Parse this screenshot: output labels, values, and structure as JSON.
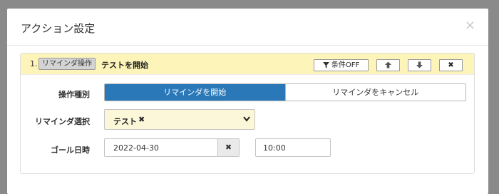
{
  "modal": {
    "title": "アクション設定",
    "close_glyph": "×"
  },
  "action": {
    "step_number": "1.",
    "type_tag": "リマインダ操作",
    "title": "テストを開始",
    "buttons": {
      "condition_label": "条件OFF",
      "condition_icon": "filter-icon",
      "move_up_icon": "arrow-up-icon",
      "move_down_icon": "arrow-down-icon",
      "delete_glyph": "✖"
    }
  },
  "form": {
    "operation_type": {
      "label": "操作種別",
      "options": [
        "リマインダを開始",
        "リマインダをキャンセル"
      ],
      "selected": "リマインダを開始"
    },
    "reminder_select": {
      "label": "リマインダ選択",
      "selected_chip": "テスト",
      "chip_remove_glyph": "✖",
      "caret_icon": "chevron-down-icon"
    },
    "goal_datetime": {
      "label": "ゴール日時",
      "date_value": "2022-04-30",
      "clear_glyph": "✖",
      "time_value": "10:00"
    }
  },
  "colors": {
    "header_highlight": "#fdf4ba",
    "select_highlight": "#fdf7d9",
    "accent": "#2a78b8",
    "overlay": "#8a8a8a"
  }
}
